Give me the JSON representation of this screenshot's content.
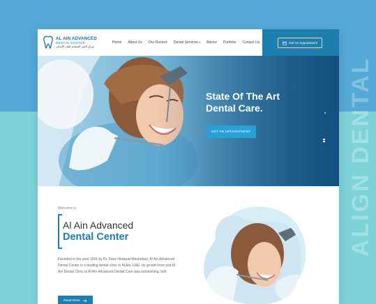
{
  "side_text": "ALIGN DENTAL",
  "logo": {
    "line1": "AL AIN ADVANCED",
    "line2": "DENTAL CENTER",
    "line3": "مركز العين المتقدم لطب الأسنان"
  },
  "nav": {
    "items": [
      "Home",
      "About Us",
      "Our Doctors",
      "Dental Services",
      "Advice",
      "Portfolio",
      "Contact Us"
    ]
  },
  "header_cta": {
    "label": "Get An Appointment",
    "icon": "calendar-icon"
  },
  "hero": {
    "title": "State Of The Art\nDental Care.",
    "button": "GET AN APPOINTMENT",
    "image": "dentist-patient-photo"
  },
  "about": {
    "welcome": "Welcome to",
    "title_line1": "Al Ain Advanced",
    "title_line2": "Dental Center",
    "paragraph": "Founded in the year 1991 by Dr. Faez Hedayat Mouhebati, Al Ain Advanced Dental Center is a leading dental clinic in Al Ain, UAE. Its growth from just Al Ain Dental Clinic to Al Ain Advanced Dental Care was astonishing, test",
    "read_more": "Read More",
    "read_more_icon": "arrow-right-icon"
  },
  "colors": {
    "primary": "#1d7fae",
    "accent": "#2b9fd6",
    "bg_top": "#54a9d6",
    "bg_bottom": "#7dd3d8"
  }
}
